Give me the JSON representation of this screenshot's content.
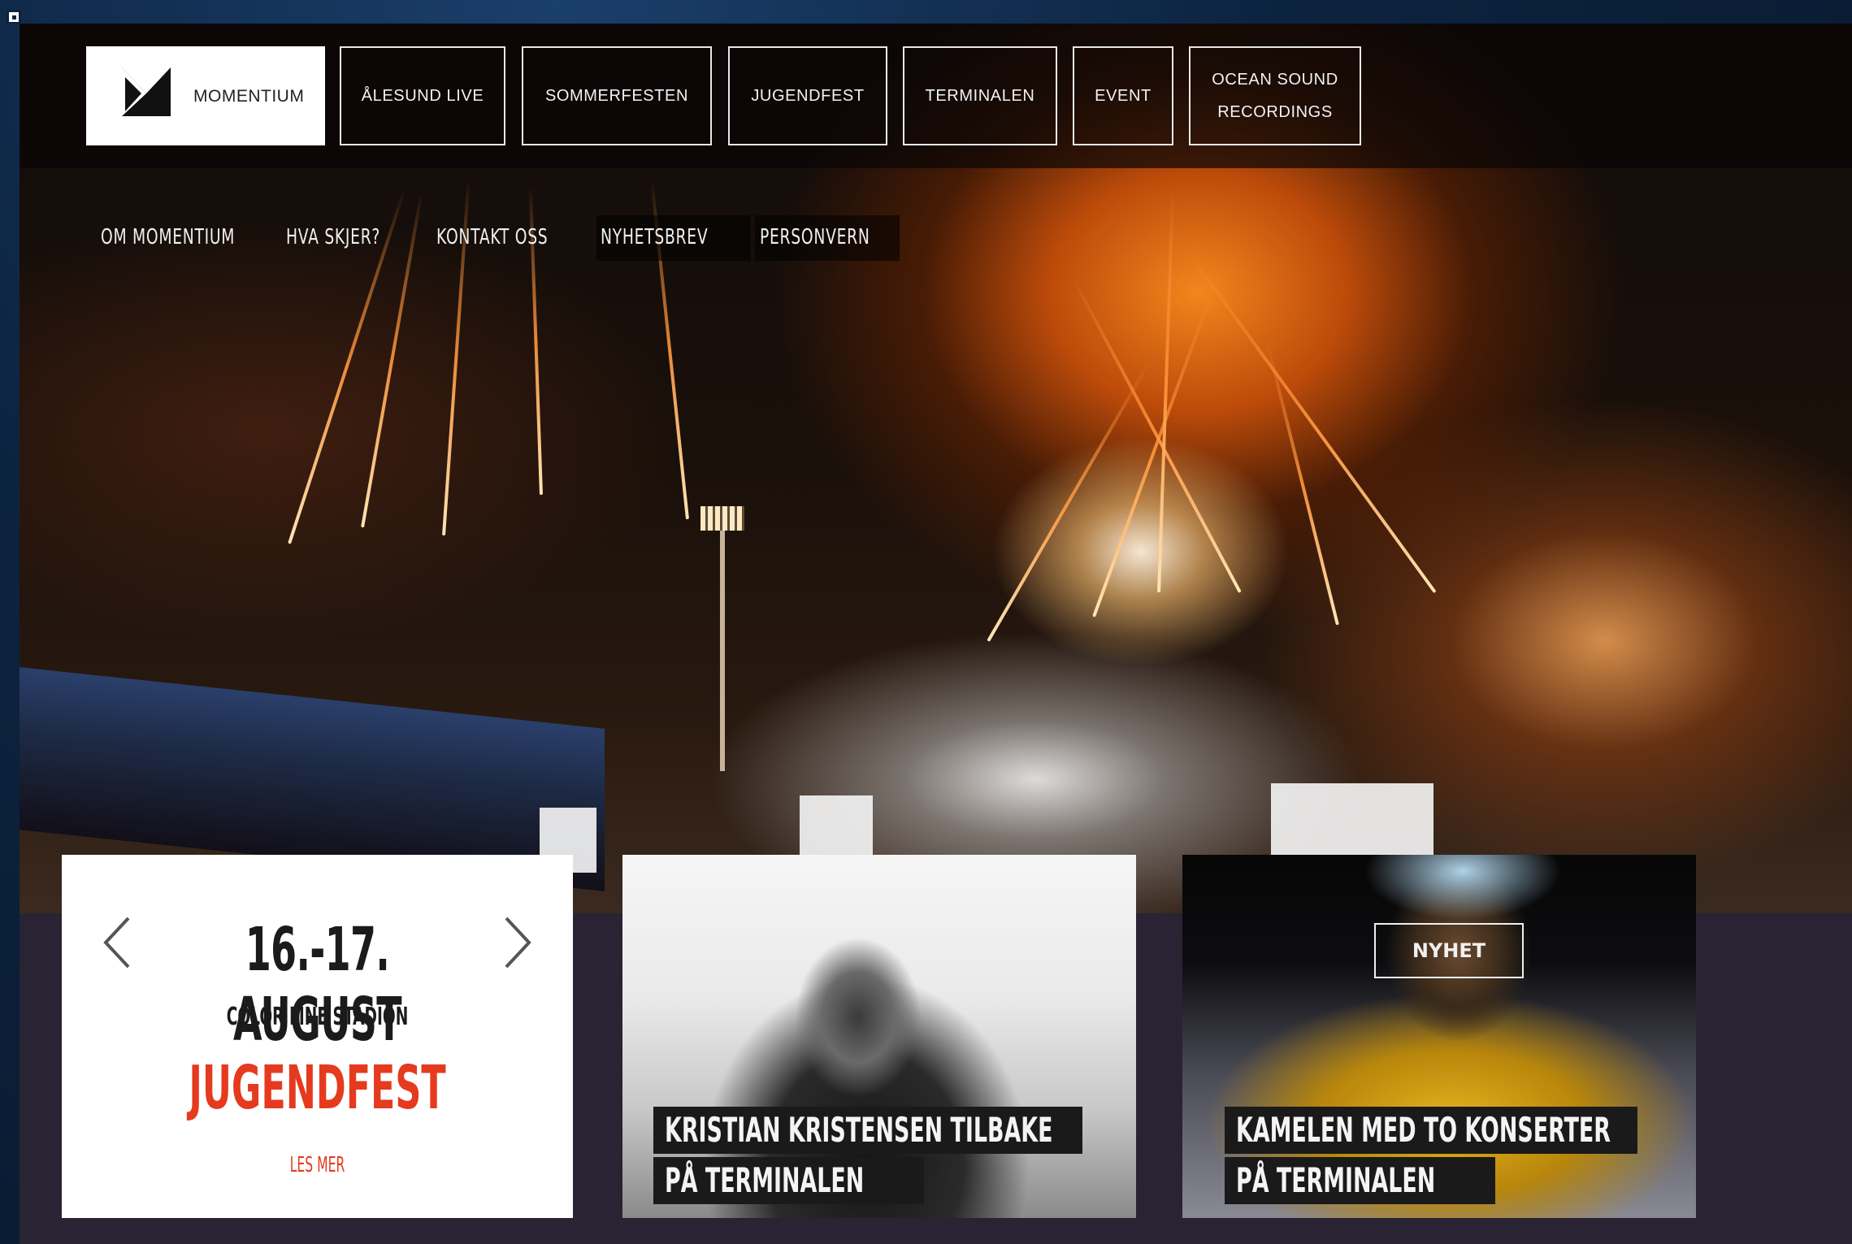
{
  "top_nav": {
    "logo_text": "MOMENTIUM",
    "items": [
      {
        "label": "ÅLESUND LIVE"
      },
      {
        "label": "SOMMERFESTEN"
      },
      {
        "label": "JUGENDFEST"
      },
      {
        "label": "TERMINALEN"
      },
      {
        "label": "EVENT"
      },
      {
        "label": "OCEAN SOUND RECORDINGS"
      }
    ]
  },
  "sub_nav": {
    "items": [
      {
        "label": "OM MOMENTIUM"
      },
      {
        "label": "HVA SKJER?"
      },
      {
        "label": "KONTAKT OSS"
      },
      {
        "label": "NYHETSBREV"
      },
      {
        "label": "PERSONVERN"
      }
    ]
  },
  "event_card": {
    "date": "16.-17. AUGUST",
    "venue": "COLOR LINE STADION",
    "event_name": "JUGENDFEST",
    "read_more": "LES MER"
  },
  "news": [
    {
      "line1": "KRISTIAN KRISTENSEN TILBAKE",
      "line2": "PÅ TERMINALEN"
    },
    {
      "tag": "NYHET",
      "line1": "KAMELEN MED TO KONSERTER",
      "line2": "PÅ TERMINALEN"
    }
  ],
  "colors": {
    "accent": "#e63a1f",
    "frame": "#0c2340",
    "bottom_bg": "#2a2333"
  }
}
